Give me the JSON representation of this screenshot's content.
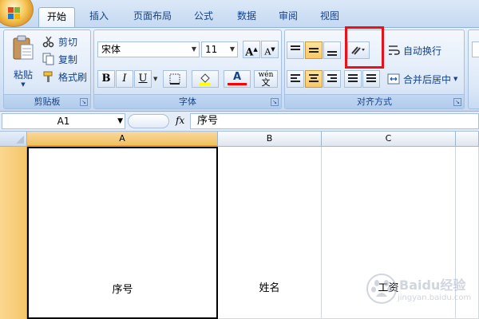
{
  "tabs": [
    {
      "label": "开始",
      "active": true
    },
    {
      "label": "插入"
    },
    {
      "label": "页面布局"
    },
    {
      "label": "公式"
    },
    {
      "label": "数据"
    },
    {
      "label": "审阅"
    },
    {
      "label": "视图"
    }
  ],
  "clipboard": {
    "paste_label": "粘贴",
    "cut_label": "剪切",
    "copy_label": "复制",
    "format_painter_label": "格式刷",
    "group_label": "剪贴板"
  },
  "font": {
    "font_name": "宋体",
    "font_size": "11",
    "grow_label": "A",
    "shrink_label": "A",
    "bold_label": "B",
    "italic_label": "I",
    "underline_label": "U",
    "font_color_label": "A",
    "phonetic_label": "wén",
    "phonetic_char": "文",
    "group_label": "字体",
    "highlight_color": "#ffff00",
    "font_color": "#ff0000"
  },
  "alignment": {
    "wrap_text_label": "自动换行",
    "merge_center_label": "合并后居中",
    "group_label": "对齐方式",
    "highlight_box_color": "#e8131a"
  },
  "formula_bar": {
    "name_box": "A1",
    "fx_label": "fx",
    "content": "序号"
  },
  "grid": {
    "columns": [
      "A",
      "B",
      "C"
    ],
    "cells": [
      "序号",
      "姓名",
      "工资"
    ]
  },
  "watermark": {
    "brand": "Baidu经验",
    "url": "jingyan.baidu.com"
  }
}
